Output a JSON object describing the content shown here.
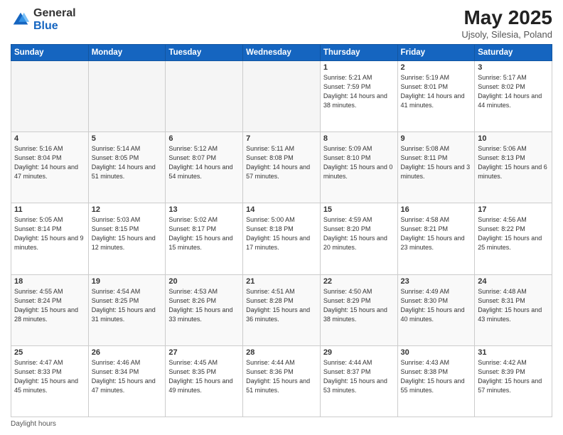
{
  "header": {
    "logo_general": "General",
    "logo_blue": "Blue",
    "month_title": "May 2025",
    "location": "Ujsoly, Silesia, Poland"
  },
  "footer": {
    "text": "Daylight hours"
  },
  "columns": [
    "Sunday",
    "Monday",
    "Tuesday",
    "Wednesday",
    "Thursday",
    "Friday",
    "Saturday"
  ],
  "weeks": [
    [
      {
        "day": "",
        "empty": true
      },
      {
        "day": "",
        "empty": true
      },
      {
        "day": "",
        "empty": true
      },
      {
        "day": "",
        "empty": true
      },
      {
        "day": "1",
        "sunrise": "5:21 AM",
        "sunset": "7:59 PM",
        "daylight": "14 hours and 38 minutes."
      },
      {
        "day": "2",
        "sunrise": "5:19 AM",
        "sunset": "8:01 PM",
        "daylight": "14 hours and 41 minutes."
      },
      {
        "day": "3",
        "sunrise": "5:17 AM",
        "sunset": "8:02 PM",
        "daylight": "14 hours and 44 minutes."
      }
    ],
    [
      {
        "day": "4",
        "sunrise": "5:16 AM",
        "sunset": "8:04 PM",
        "daylight": "14 hours and 47 minutes."
      },
      {
        "day": "5",
        "sunrise": "5:14 AM",
        "sunset": "8:05 PM",
        "daylight": "14 hours and 51 minutes."
      },
      {
        "day": "6",
        "sunrise": "5:12 AM",
        "sunset": "8:07 PM",
        "daylight": "14 hours and 54 minutes."
      },
      {
        "day": "7",
        "sunrise": "5:11 AM",
        "sunset": "8:08 PM",
        "daylight": "14 hours and 57 minutes."
      },
      {
        "day": "8",
        "sunrise": "5:09 AM",
        "sunset": "8:10 PM",
        "daylight": "15 hours and 0 minutes."
      },
      {
        "day": "9",
        "sunrise": "5:08 AM",
        "sunset": "8:11 PM",
        "daylight": "15 hours and 3 minutes."
      },
      {
        "day": "10",
        "sunrise": "5:06 AM",
        "sunset": "8:13 PM",
        "daylight": "15 hours and 6 minutes."
      }
    ],
    [
      {
        "day": "11",
        "sunrise": "5:05 AM",
        "sunset": "8:14 PM",
        "daylight": "15 hours and 9 minutes."
      },
      {
        "day": "12",
        "sunrise": "5:03 AM",
        "sunset": "8:15 PM",
        "daylight": "15 hours and 12 minutes."
      },
      {
        "day": "13",
        "sunrise": "5:02 AM",
        "sunset": "8:17 PM",
        "daylight": "15 hours and 15 minutes."
      },
      {
        "day": "14",
        "sunrise": "5:00 AM",
        "sunset": "8:18 PM",
        "daylight": "15 hours and 17 minutes."
      },
      {
        "day": "15",
        "sunrise": "4:59 AM",
        "sunset": "8:20 PM",
        "daylight": "15 hours and 20 minutes."
      },
      {
        "day": "16",
        "sunrise": "4:58 AM",
        "sunset": "8:21 PM",
        "daylight": "15 hours and 23 minutes."
      },
      {
        "day": "17",
        "sunrise": "4:56 AM",
        "sunset": "8:22 PM",
        "daylight": "15 hours and 25 minutes."
      }
    ],
    [
      {
        "day": "18",
        "sunrise": "4:55 AM",
        "sunset": "8:24 PM",
        "daylight": "15 hours and 28 minutes."
      },
      {
        "day": "19",
        "sunrise": "4:54 AM",
        "sunset": "8:25 PM",
        "daylight": "15 hours and 31 minutes."
      },
      {
        "day": "20",
        "sunrise": "4:53 AM",
        "sunset": "8:26 PM",
        "daylight": "15 hours and 33 minutes."
      },
      {
        "day": "21",
        "sunrise": "4:51 AM",
        "sunset": "8:28 PM",
        "daylight": "15 hours and 36 minutes."
      },
      {
        "day": "22",
        "sunrise": "4:50 AM",
        "sunset": "8:29 PM",
        "daylight": "15 hours and 38 minutes."
      },
      {
        "day": "23",
        "sunrise": "4:49 AM",
        "sunset": "8:30 PM",
        "daylight": "15 hours and 40 minutes."
      },
      {
        "day": "24",
        "sunrise": "4:48 AM",
        "sunset": "8:31 PM",
        "daylight": "15 hours and 43 minutes."
      }
    ],
    [
      {
        "day": "25",
        "sunrise": "4:47 AM",
        "sunset": "8:33 PM",
        "daylight": "15 hours and 45 minutes."
      },
      {
        "day": "26",
        "sunrise": "4:46 AM",
        "sunset": "8:34 PM",
        "daylight": "15 hours and 47 minutes."
      },
      {
        "day": "27",
        "sunrise": "4:45 AM",
        "sunset": "8:35 PM",
        "daylight": "15 hours and 49 minutes."
      },
      {
        "day": "28",
        "sunrise": "4:44 AM",
        "sunset": "8:36 PM",
        "daylight": "15 hours and 51 minutes."
      },
      {
        "day": "29",
        "sunrise": "4:44 AM",
        "sunset": "8:37 PM",
        "daylight": "15 hours and 53 minutes."
      },
      {
        "day": "30",
        "sunrise": "4:43 AM",
        "sunset": "8:38 PM",
        "daylight": "15 hours and 55 minutes."
      },
      {
        "day": "31",
        "sunrise": "4:42 AM",
        "sunset": "8:39 PM",
        "daylight": "15 hours and 57 minutes."
      }
    ]
  ]
}
